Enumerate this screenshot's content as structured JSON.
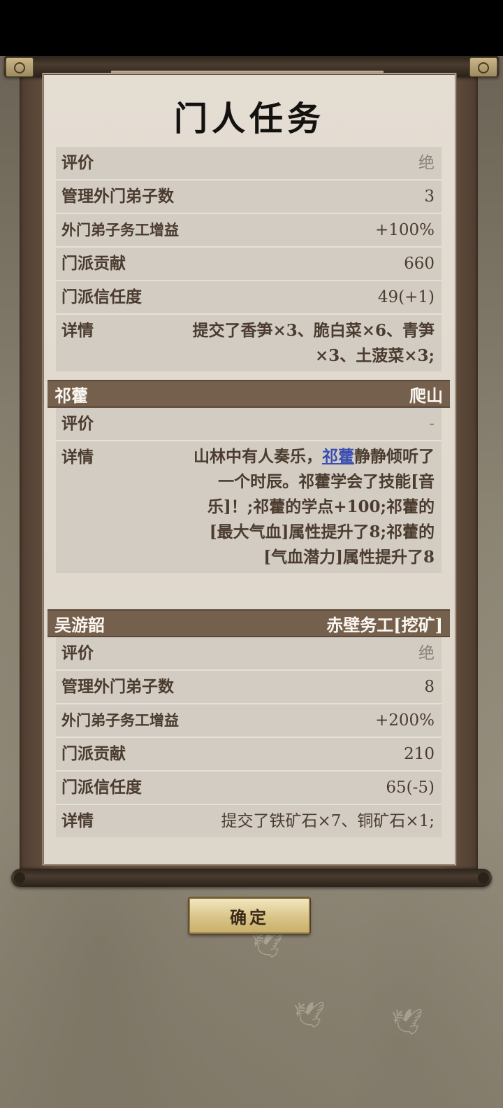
{
  "title": "门人任务",
  "sections": [
    {
      "header_name": "",
      "header_task": "",
      "rows": [
        {
          "label": "评价",
          "value": "绝"
        },
        {
          "label": "管理外门弟子数",
          "value": "3"
        },
        {
          "label": "外门弟子务工增益",
          "value": "+100%"
        },
        {
          "label": "门派贡献",
          "value": "660"
        },
        {
          "label": "门派信任度",
          "value": "49(+1)"
        },
        {
          "label": "详情",
          "value": "提交了香笋×3、脆白菜×6、青笋×3、土菠菜×3;"
        }
      ]
    },
    {
      "header_name": "祁藿",
      "header_task": "爬山",
      "rows": [
        {
          "label": "评价",
          "value": "-"
        },
        {
          "label": "详情",
          "value_prefix": "山林中有人奏乐，",
          "value_link": "祁藿",
          "value_suffix": "静静倾听了一个时辰。祁藿学会了技能[音乐]！;祁藿的学点+100;祁藿的[最大气血]属性提升了8;祁藿的[气血潜力]属性提升了8"
        }
      ]
    },
    {
      "header_name": "吴游韶",
      "header_task": "赤壁务工[挖矿]",
      "rows": [
        {
          "label": "评价",
          "value": "绝"
        },
        {
          "label": "管理外门弟子数",
          "value": "8"
        },
        {
          "label": "外门弟子务工增益",
          "value": "+200%"
        },
        {
          "label": "门派贡献",
          "value": "210"
        },
        {
          "label": "门派信任度",
          "value": "65(-5)"
        },
        {
          "label": "详情",
          "value": "提交了铁矿石×7、铜矿石×1;"
        }
      ]
    }
  ],
  "confirm_label": "确定",
  "icons": {
    "rod_cap": "scroll-rod-cap-icon",
    "bird": "crane-decoration-icon"
  }
}
